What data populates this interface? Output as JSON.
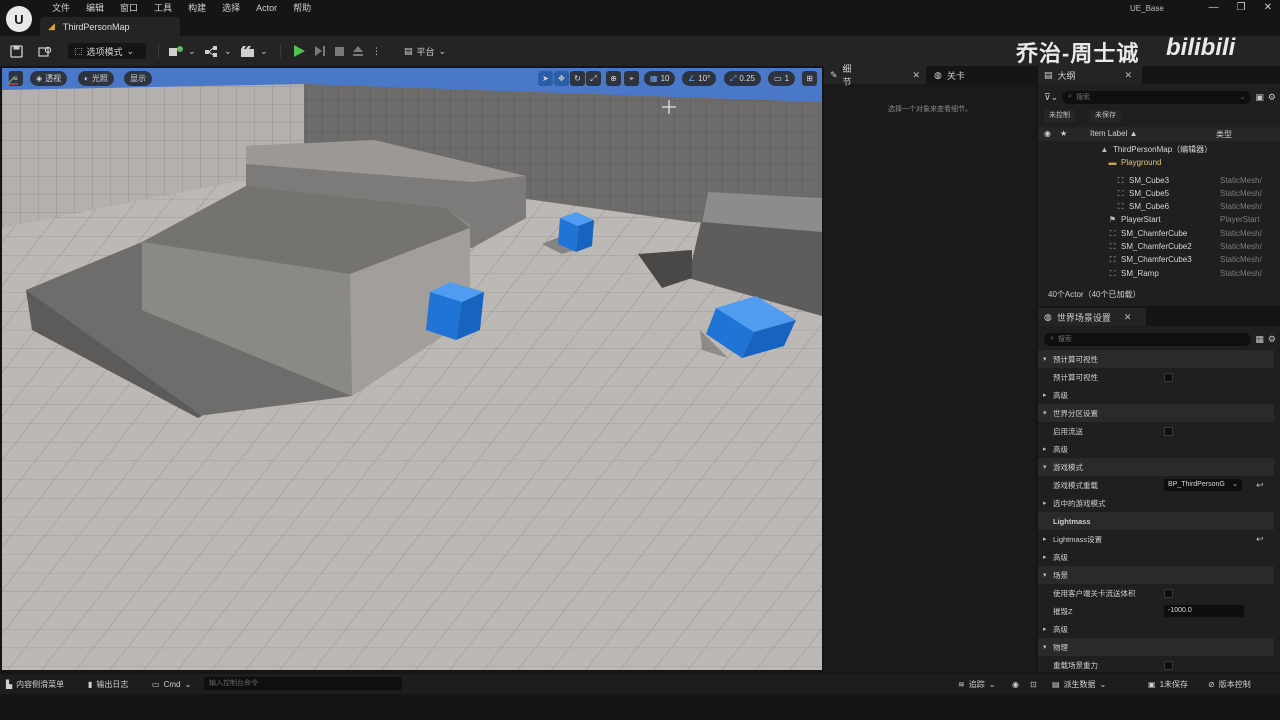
{
  "menu": {
    "logo": "U",
    "items": [
      "文件",
      "编辑",
      "窗口",
      "工具",
      "构建",
      "选择",
      "Actor",
      "帮助"
    ],
    "project_name": "UE_Base",
    "window_controls": [
      "—",
      "❐",
      "✕"
    ]
  },
  "tab": {
    "label": "ThirdPersonMap",
    "icon": "map-icon"
  },
  "toolbar": {
    "select_mode": "选项模式",
    "platform": "平台"
  },
  "watermark": {
    "text": "乔治-周士诚",
    "logo": "bilibili"
  },
  "viewport": {
    "perspective": "透视",
    "lighting": "光照",
    "show": "显示",
    "grid_snap": "10",
    "rotate_snap": "10°",
    "scale_snap": "0.25",
    "camera_speed": "1",
    "colors": {
      "sky": "#4a78c8",
      "cube": "#1f74d6",
      "floor": "#b9b5b2",
      "block": "#7a7877"
    }
  },
  "details": {
    "tabs": [
      {
        "label": "细节"
      },
      {
        "label": "关卡"
      }
    ],
    "empty_message": "选择一个对象来查看细节。"
  },
  "outliner": {
    "title": "大纲",
    "search_placeholder": "搜索",
    "chips": [
      "未控制",
      "未保存"
    ],
    "columns": {
      "label": "Item Label ▲",
      "type": "类型"
    },
    "rows": [
      {
        "name": "ThirdPersonMap（编辑器）",
        "type": "",
        "kind": "map"
      },
      {
        "name": "Playground",
        "type": "",
        "kind": "folder"
      },
      {
        "name": "SM_Cube3",
        "type": "StaticMesh/",
        "kind": "mesh"
      },
      {
        "name": "SM_Cube5",
        "type": "StaticMesh/",
        "kind": "mesh"
      },
      {
        "name": "SM_Cube6",
        "type": "StaticMesh/",
        "kind": "mesh"
      },
      {
        "name": "PlayerStart",
        "type": "PlayerStart",
        "kind": "actor"
      },
      {
        "name": "SM_ChamferCube",
        "type": "StaticMesh/",
        "kind": "mesh"
      },
      {
        "name": "SM_ChamferCube2",
        "type": "StaticMesh/",
        "kind": "mesh"
      },
      {
        "name": "SM_ChamferCube3",
        "type": "StaticMesh/",
        "kind": "mesh"
      },
      {
        "name": "SM_Ramp",
        "type": "StaticMesh/",
        "kind": "mesh"
      }
    ],
    "status": "40个Actor（40个已加载）"
  },
  "world_settings": {
    "title": "世界场景设置",
    "search_placeholder": "搜索",
    "rows": [
      {
        "label": "预计算可视性",
        "kind": "section"
      },
      {
        "label": "预计算可视性",
        "kind": "checkbox"
      },
      {
        "label": "高级",
        "kind": "collapsed"
      },
      {
        "label": "世界分区设置",
        "kind": "section"
      },
      {
        "label": "启用流送",
        "kind": "checkbox"
      },
      {
        "label": "高级",
        "kind": "collapsed"
      },
      {
        "label": "游戏模式",
        "kind": "section"
      },
      {
        "label": "游戏模式重载",
        "kind": "dropdown",
        "value": "BP_ThirdPersonG"
      },
      {
        "label": "选中的游戏模式",
        "kind": "collapsed"
      },
      {
        "label": "Lightmass",
        "kind": "section"
      },
      {
        "label": "Lightmass设置",
        "kind": "collapsed-reset"
      },
      {
        "label": "高级",
        "kind": "collapsed"
      },
      {
        "label": "场景",
        "kind": "section"
      },
      {
        "label": "使用客户端关卡流送体积",
        "kind": "checkbox"
      },
      {
        "label": "摧毁Z",
        "kind": "number",
        "value": "-1000.0"
      },
      {
        "label": "高级",
        "kind": "collapsed"
      },
      {
        "label": "物理",
        "kind": "section"
      },
      {
        "label": "重载场景重力",
        "kind": "checkbox"
      }
    ]
  },
  "statusbar": {
    "content_drawer": "内容侧滑菜单",
    "output_log": "输出日志",
    "cmd": "Cmd",
    "cmd_placeholder": "输入控制台命令",
    "trace": "追踪",
    "derived_data": "派生数据",
    "unsaved": "1未保存",
    "source_control": "版本控制"
  }
}
